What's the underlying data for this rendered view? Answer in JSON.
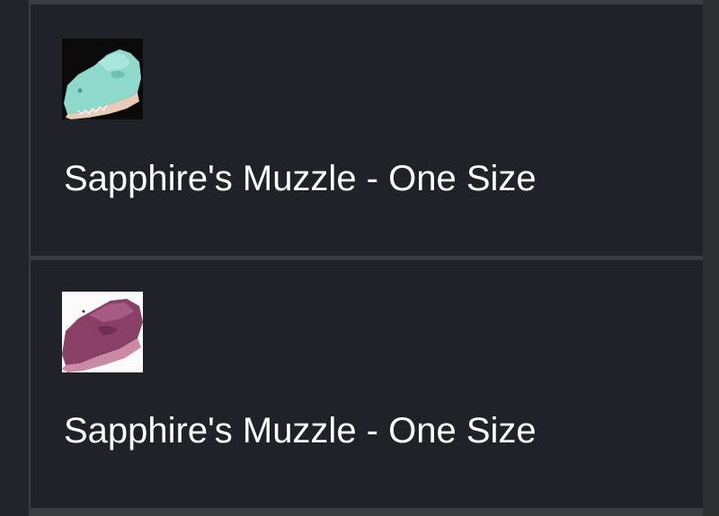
{
  "items": [
    {
      "title": "Sapphire's Muzzle - One Size",
      "thumbnail": "teal-muzzle-photo",
      "thumb_bg": "#0a0a0a",
      "thumb_color": "#8fd9cc"
    },
    {
      "title": "Sapphire's Muzzle - One Size",
      "thumbnail": "purple-muzzle-photo",
      "thumb_bg": "#fafafa",
      "thumb_color": "#8a3f66"
    }
  ]
}
